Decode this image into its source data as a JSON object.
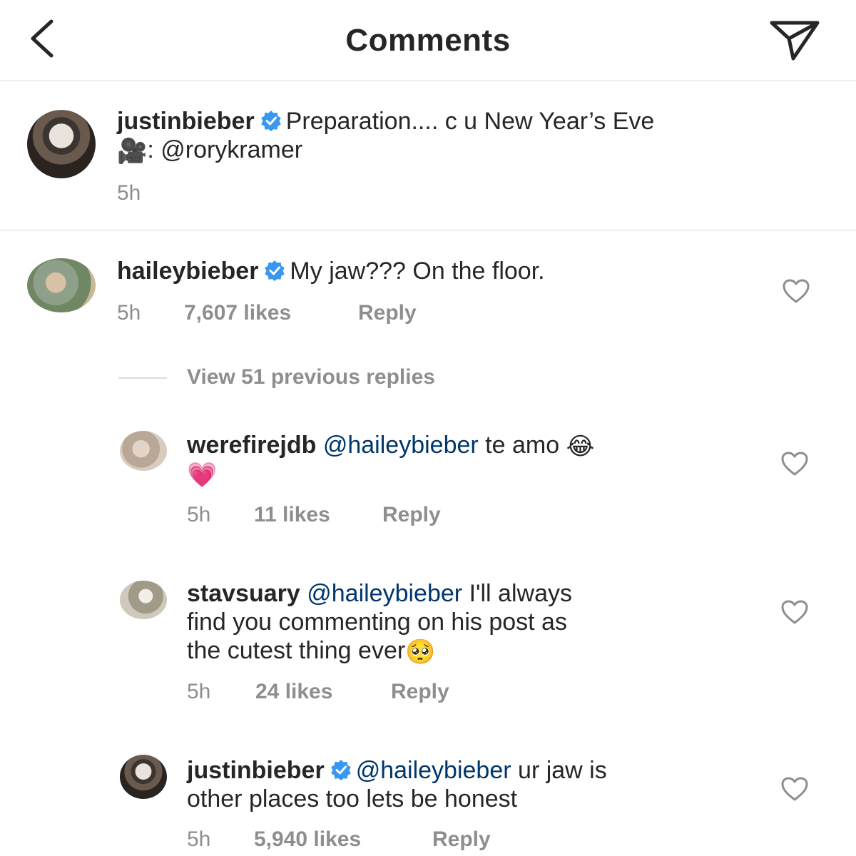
{
  "header": {
    "title": "Comments",
    "back_icon": "chevron-left-icon",
    "share_icon": "paper-plane-icon"
  },
  "caption": {
    "username": "justinbieber",
    "verified": true,
    "text_line1": "Preparation.... c u New Year’s Eve",
    "camera_emoji": "🎥",
    "text_line2": ": @rorykramer",
    "time": "5h"
  },
  "comment": {
    "username": "haileybieber",
    "verified": true,
    "text": "My jaw??? On the floor.",
    "time": "5h",
    "likes": "7,607 likes",
    "reply": "Reply"
  },
  "view_replies": "View 51 previous replies",
  "replies": [
    {
      "username": "werefirejdb",
      "mention": "@haileybieber",
      "text": "te amo",
      "emoji_1": "😂",
      "emoji_2": "💗",
      "time": "5h",
      "likes": "11 likes",
      "reply": "Reply"
    },
    {
      "username": "stavsuary",
      "mention": "@haileybieber",
      "text_line1": "I'll always",
      "text_line2": "find you commenting on his post as",
      "text_line3": "the cutest thing ever",
      "emoji": "🥺",
      "time": "5h",
      "likes": "24 likes",
      "reply": "Reply"
    },
    {
      "username": "justinbieber",
      "verified": true,
      "mention": "@haileybieber",
      "text_line1": "ur jaw is",
      "text_line2": "other places too lets be honest",
      "time": "5h",
      "likes": "5,940 likes",
      "reply": "Reply"
    }
  ],
  "colors": {
    "text": "#262626",
    "secondary": "#8e8e8e",
    "mention": "#00376b",
    "verified": "#3897f0",
    "divider": "#efefef"
  }
}
